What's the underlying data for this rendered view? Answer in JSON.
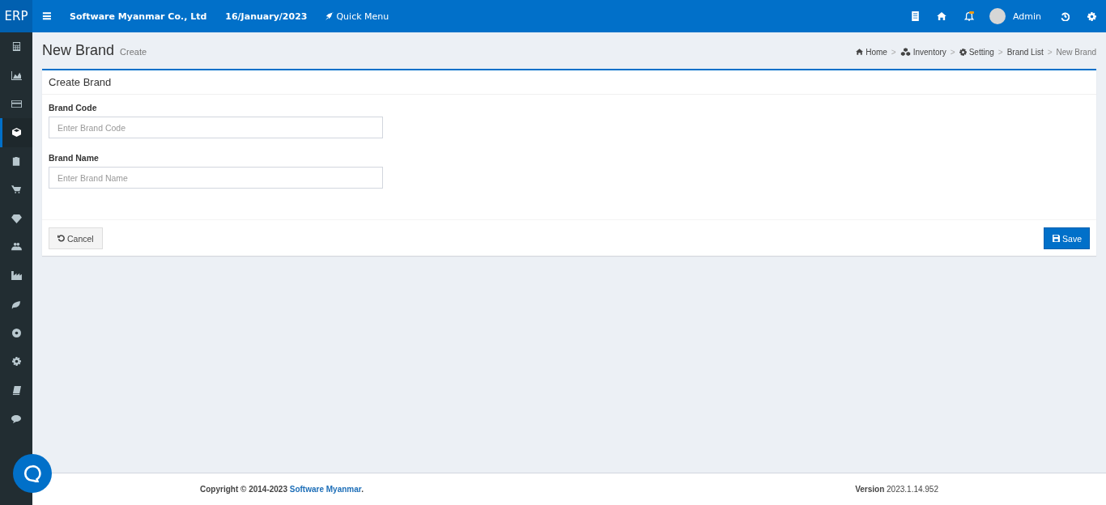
{
  "topbar": {
    "logo": "ERP",
    "menu_glyph": "≡",
    "company": "Software Myanmar Co., Ltd",
    "date": "16/January/2023",
    "quick_menu": "Quick Menu",
    "user": "Admin"
  },
  "sidebar": {
    "items": [
      {
        "selected": false
      },
      {
        "selected": false
      },
      {
        "selected": false
      },
      {
        "selected": true
      },
      {
        "selected": false
      },
      {
        "selected": false
      },
      {
        "selected": false
      },
      {
        "selected": false
      },
      {
        "selected": false
      },
      {
        "selected": false
      },
      {
        "selected": false
      },
      {
        "selected": false
      },
      {
        "selected": false
      },
      {
        "selected": false
      }
    ]
  },
  "page_header": {
    "title": "New Brand",
    "subtitle": "Create"
  },
  "breadcrumb": [
    {
      "label": "Home"
    },
    {
      "label": "Inventory"
    },
    {
      "label": "Setting"
    },
    {
      "label": "Brand List"
    },
    {
      "label": "New Brand"
    }
  ],
  "breadcrumb_separator": ">",
  "card": {
    "title": "Create Brand",
    "fields": [
      {
        "label": "Brand Code",
        "placeholder": "Enter Brand Code"
      },
      {
        "label": "Brand Name",
        "placeholder": "Enter Brand Name"
      }
    ],
    "cancel": "Cancel",
    "save": "Save"
  },
  "footer": {
    "copyright": "Copyright © 2014-2023 ",
    "link": "Software Myanmar",
    "link_suffix": ".",
    "version": "**Version** 2023.1.14.952"
  }
}
